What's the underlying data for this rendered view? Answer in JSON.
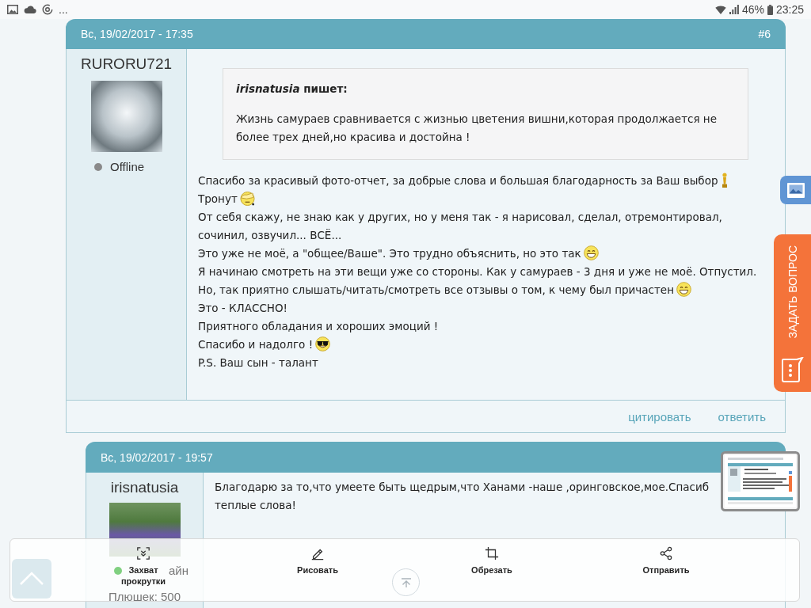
{
  "status_bar": {
    "overflow": "...",
    "battery": "46%",
    "time": "23:25"
  },
  "posts": [
    {
      "date": "Вс, 19/02/2017 - 17:35",
      "number": "#6",
      "author": {
        "name": "RURORU721",
        "status": "Offline",
        "online": false
      },
      "quote": {
        "attribution": "*irisnatusia* пишет:",
        "text": "Жизнь самураев сравнивается с жизнью цветения вишни,которая продолжается не более трех дней,но красива и достойна !"
      },
      "lines": [
        {
          "text": "Спасибо за красивый фото-отчет, за добрые слова и большая благодарность за Ваш выбор",
          "kind": "statuette"
        },
        {
          "text": "Тронут",
          "kind": "face-hand"
        },
        {
          "text": "От себя скажу, не знаю как у других, но у меня так - я нарисовал, сделал, отремонтировал, сочинил, озвучил... ВСЁ...",
          "kind": "plain"
        },
        {
          "text": "Это уже не моё, а \"общее/Ваше\". Это трудно объяснить, но это так",
          "kind": "grin"
        },
        {
          "text": "Я начинаю смотреть на эти вещи уже со стороны. Как у самураев - 3 дня и уже не моё. Отпустил.",
          "kind": "plain"
        },
        {
          "text": "Но, так приятно слышать/читать/смотреть все отзывы о том, к чему был причастен",
          "kind": "grin"
        },
        {
          "text": "Это - КЛАССНО!",
          "kind": "plain"
        },
        {
          "text": "Приятного обладания и хороших эмоций !",
          "kind": "plain"
        },
        {
          "text": "Спасибо и надолго !",
          "kind": "sunglasses"
        },
        {
          "text": "P.S. Ваш сын - талант",
          "kind": "plain"
        }
      ],
      "actions": [
        "цитировать",
        "ответить"
      ],
      "children": [
        {
          "date": "Вс, 19/02/2017 - 19:57",
          "author": {
            "name": "irisnatusia",
            "status": "айн",
            "online": true,
            "points": "Плюшек: 500"
          },
          "lines": [
            {
              "text": "Благодарю за то,что умеете быть щедрым,что Ханами -наше ,оринговское,мое.Спасиб",
              "kind": "plain"
            },
            {
              "text": "теплые слова!",
              "kind": "plain"
            }
          ]
        }
      ]
    }
  ],
  "side_panel": {
    "ask_label": "ЗАДАТЬ ВОПРОС"
  },
  "capture_toolbar": {
    "actions": [
      {
        "label": "Захват прокрутки",
        "kind": "scroll-capture"
      },
      {
        "label": "Рисовать",
        "kind": "draw"
      },
      {
        "label": "Обрезать",
        "kind": "crop"
      },
      {
        "label": "Отправить",
        "kind": "share"
      }
    ]
  }
}
